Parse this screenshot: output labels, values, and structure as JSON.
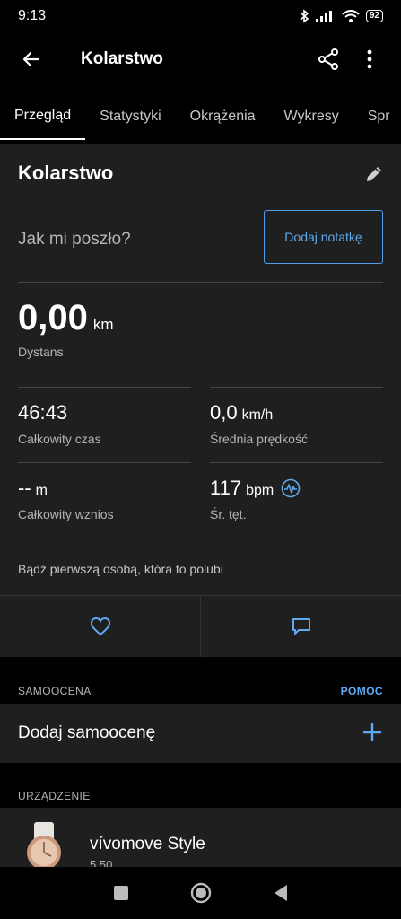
{
  "status": {
    "time": "9:13",
    "battery": "92"
  },
  "appbar": {
    "title": "Kolarstwo"
  },
  "tabs": [
    "Przegląd",
    "Statystyki",
    "Okrążenia",
    "Wykresy",
    "Spr"
  ],
  "summary": {
    "heading": "Kolarstwo",
    "question": "Jak mi poszło?",
    "note_button": "Dodaj notatkę",
    "distance": {
      "value": "0,00",
      "unit": "km",
      "label": "Dystans"
    },
    "stats": [
      {
        "value": "46:43",
        "unit": "",
        "label": "Całkowity czas"
      },
      {
        "value": "0,0",
        "unit": "km/h",
        "label": "Średnia prędkość"
      },
      {
        "value": "--",
        "unit": "m",
        "label": "Całkowity wznios"
      },
      {
        "value": "117",
        "unit": "bpm",
        "label": "Śr. tęt."
      }
    ],
    "likes_text": "Bądź pierwszą osobą, która to polubi"
  },
  "self_eval": {
    "section": "SAMOOCENA",
    "help": "POMOC",
    "label": "Dodaj samoocenę"
  },
  "device": {
    "section": "URZĄDZENIE",
    "name": "vívomove Style",
    "version": "5.50"
  },
  "colors": {
    "accent": "#4f9ee8",
    "card": "#1f1f1f",
    "background": "#000000"
  }
}
